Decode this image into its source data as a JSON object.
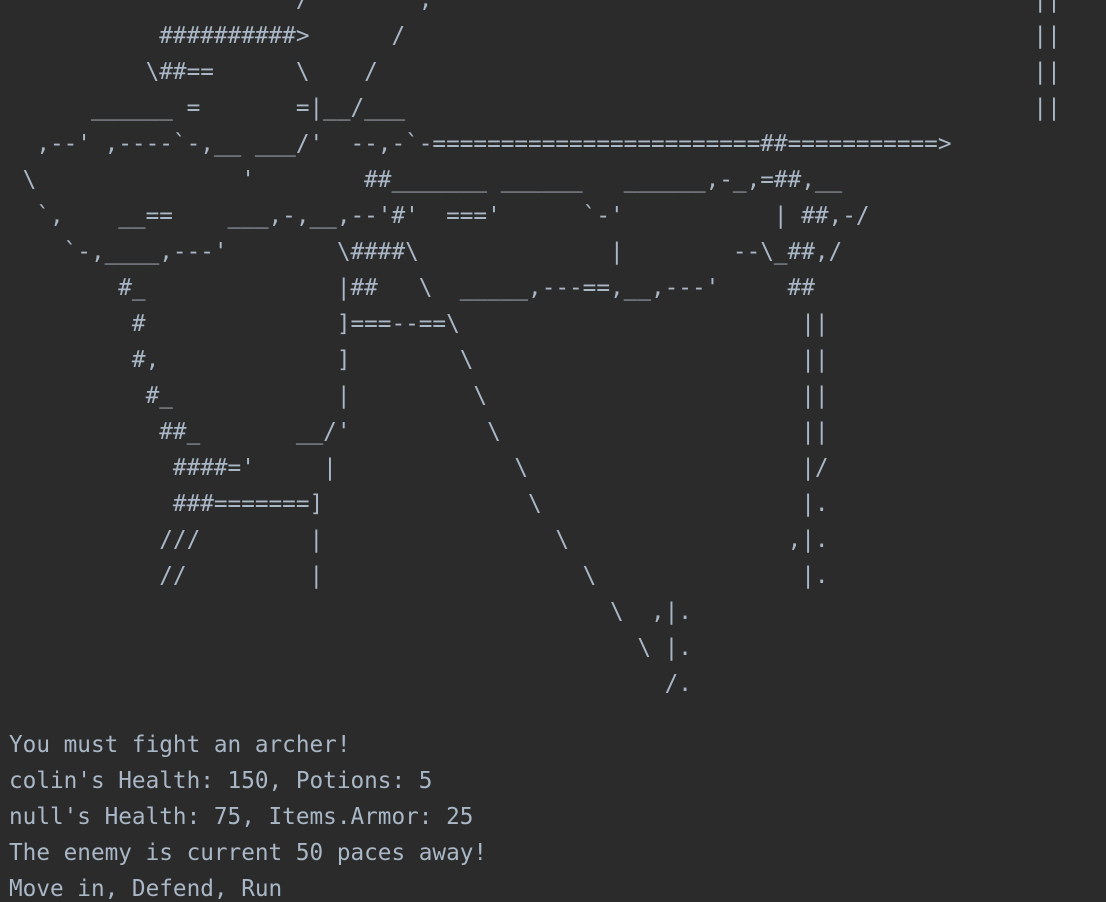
{
  "console": {
    "ascii_art": "                     /        ,                                            ||\n           ##########>      /                                              ||\n          \\##==      \\    /                                                ||\n      ______ =       =|__/___                                              ||\n  ,--' ,----`-,__ ___/'  --,-`-========================##===========>\n \\               '        ##_______ ______   ______,-_,=##,__\n  `,    __==    ___,-,__,--'#'  ==='      `-'           | ##,-/\n    `-,____,---'        \\####\\              |        --\\_##,/\n        #_              |##   \\  _____,---==,__,---'     ##\n         #              ]===--==\\                         ||\n         #,             ]        \\                        ||\n          #_            |         \\                       ||\n           ##_       __/'          \\                      ||\n            ####='     |             \\                    |/\n            ###=======]               \\                   |.\n           ///        |                 \\                ,|.\n           //         |                   \\               |.\n                                            \\  ,|.\n                                              \\ |.\n                                                /.",
    "lines": [
      "You must fight an archer!",
      "colin's Health: 150, Potions: 5",
      "null's Health: 75, Items.Armor: 25",
      "The enemy is current 50 paces away!",
      "Move in, Defend, Run"
    ]
  },
  "colors": {
    "background": "#2b2b2b",
    "text": "#a9b7c6"
  }
}
